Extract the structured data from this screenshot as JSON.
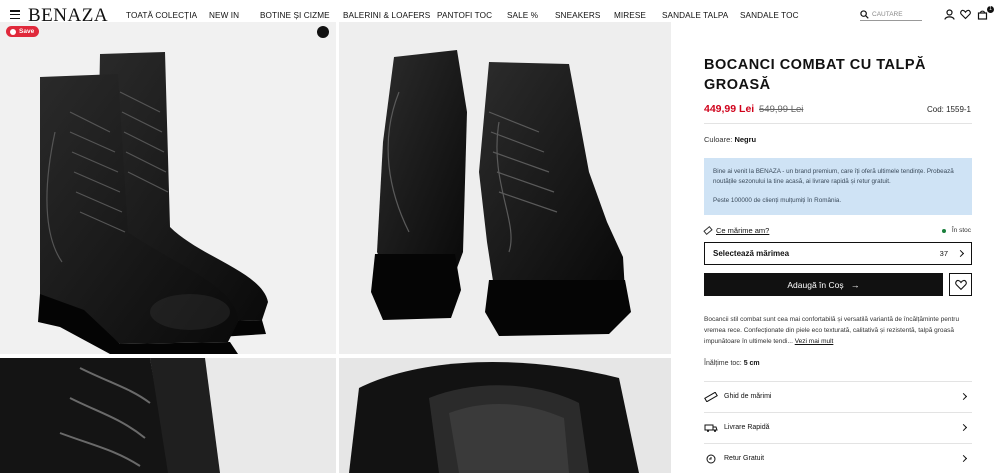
{
  "header": {
    "logo": "BENAZA",
    "nav": [
      "TOATĂ COLECȚIA",
      "NEW IN",
      "BOTINE ȘI CIZME",
      "BALERINI & LOAFERS",
      "PANTOFI TOC",
      "SALE %",
      "SNEAKERS",
      "MIRESE",
      "SANDALE TALPA",
      "SANDALE TOC"
    ],
    "search_placeholder": "CĂUTARE",
    "cart_count": "1",
    "icons": [
      "menu-icon",
      "search-icon",
      "user-icon",
      "heart-icon",
      "cart-icon"
    ]
  },
  "gallery": {
    "save_label": "Save",
    "images": [
      "boots-front-view",
      "boots-back-view",
      "lace-detail",
      "lining-detail"
    ]
  },
  "product": {
    "title": "BOCANCI COMBAT CU TALPĂ GROASĂ",
    "price": "449,99 Lei",
    "old_price": "549,99 Lei",
    "code": "Cod: 1559-1",
    "color_label": "Culoare: ",
    "color_value": "Negru",
    "info_line1": "Bine ai venit la BENAZA - un brand premium, care îți oferă ultimele tendințe. Probează noutățile sezonului la tine acasă, ai livrare rapidă și retur gratuit.",
    "info_line2": "Peste 100000 de clienți mulțumiți în România.",
    "size_guide_link": "Ce mărime am?",
    "stock": "În stoc",
    "size_select_label": "Selectează mărimea",
    "size_select_value": "37",
    "add_to_cart": "Adaugă în Coș",
    "description": "Bocancii stil combat sunt cea mai confortabilă și versatilă variantă de încălțăminte pentru vremea rece. Confecționate din piele eco texturată, calitativă și rezistentă, talpă groasă impunătoare în ultimele tendi...",
    "read_more": "Vezi mai mult",
    "heel_label": "Înălțime toc: ",
    "heel_value": "5 cm",
    "service_rows": [
      "Ghid de mărimi",
      "Livrare Rapidă",
      "Retur Gratuit"
    ]
  },
  "colors": {
    "accent": "#d0021b",
    "info_bg": "#cfe3f5",
    "button_bg": "#111111"
  }
}
